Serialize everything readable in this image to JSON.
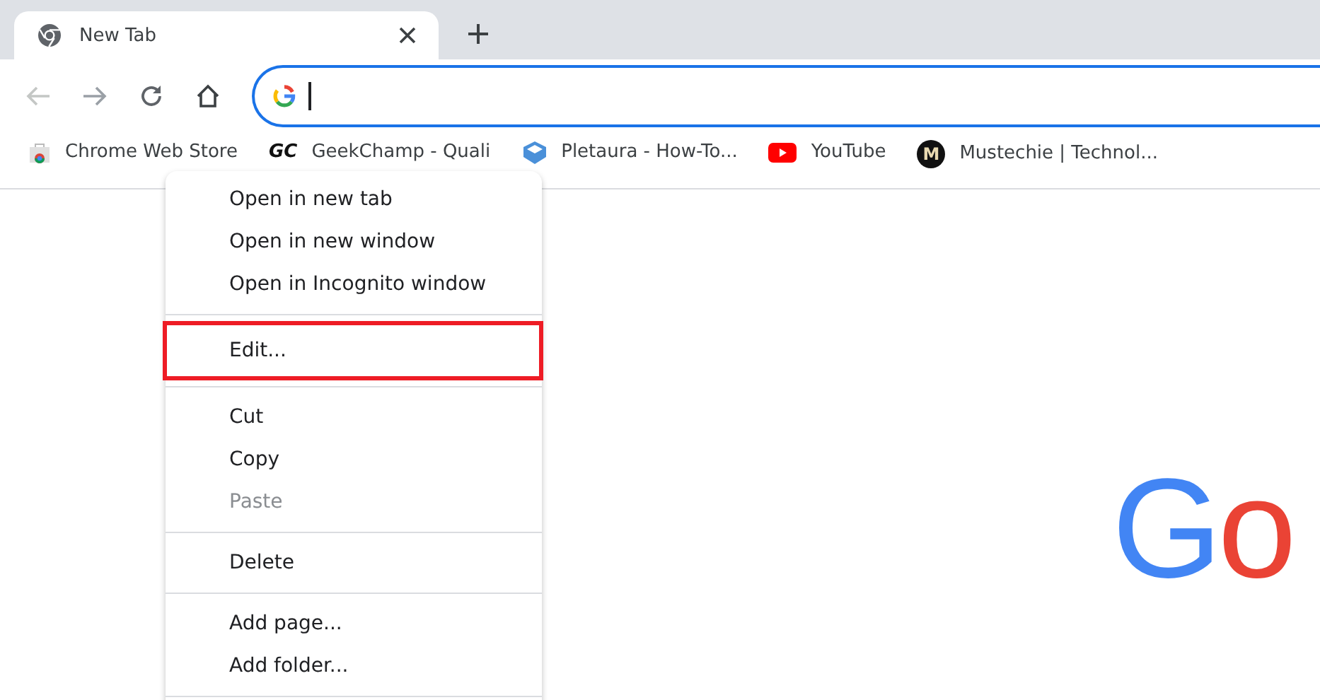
{
  "tab": {
    "title": "New Tab",
    "selected": true
  },
  "bookmarks": [
    {
      "kind": "store",
      "label": "Chrome Web Store"
    },
    {
      "kind": "letters",
      "favicon_text": "GC",
      "label": "GeekChamp - Quali"
    },
    {
      "kind": "box",
      "label": "Pletaura - How-To..."
    },
    {
      "kind": "play",
      "label": "YouTube"
    },
    {
      "kind": "circle",
      "favicon_text": "M",
      "label": "Mustechie | Technol..."
    }
  ],
  "context_menu": [
    {
      "kind": "item",
      "label": "Open in new tab",
      "disabled": false,
      "highlighted": false
    },
    {
      "kind": "item",
      "label": "Open in new window",
      "disabled": false,
      "highlighted": false
    },
    {
      "kind": "item",
      "label": "Open in Incognito window",
      "disabled": false,
      "highlighted": false
    },
    {
      "kind": "separator"
    },
    {
      "kind": "item",
      "label": "Edit...",
      "disabled": false,
      "highlighted": true
    },
    {
      "kind": "separator"
    },
    {
      "kind": "item",
      "label": "Cut",
      "disabled": false,
      "highlighted": false
    },
    {
      "kind": "item",
      "label": "Copy",
      "disabled": false,
      "highlighted": false
    },
    {
      "kind": "item",
      "label": "Paste",
      "disabled": true,
      "highlighted": false
    },
    {
      "kind": "separator"
    },
    {
      "kind": "item",
      "label": "Delete",
      "disabled": false,
      "highlighted": false
    },
    {
      "kind": "separator"
    },
    {
      "kind": "item",
      "label": "Add page...",
      "disabled": false,
      "highlighted": false
    },
    {
      "kind": "item",
      "label": "Add folder...",
      "disabled": false,
      "highlighted": false
    },
    {
      "kind": "separator"
    }
  ],
  "logo": [
    {
      "text": "G",
      "color": "#4285f4"
    },
    {
      "text": "o",
      "color": "#ea4335"
    }
  ]
}
